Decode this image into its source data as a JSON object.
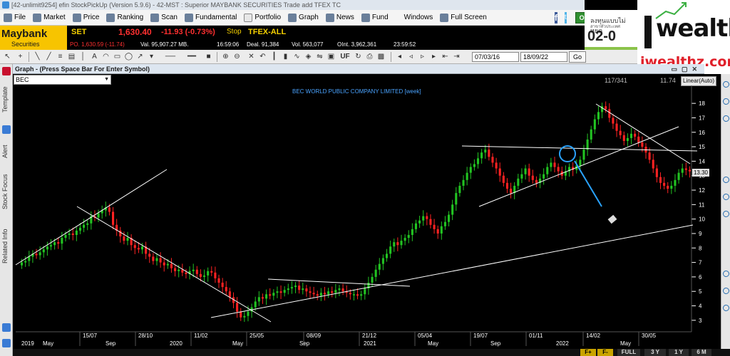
{
  "title_bar": "[42-unlimit9254] efin StockPickUp (Version 5.9.6) - 42-MST : Superior MAYBANK SECURITIES Trade add TFEX TC",
  "menu": [
    {
      "label": "File",
      "icon": "file-icon"
    },
    {
      "label": "Market",
      "icon": "market-icon"
    },
    {
      "label": "Price",
      "icon": "price-icon"
    },
    {
      "label": "Ranking",
      "icon": "ranking-icon"
    },
    {
      "label": "Scan",
      "icon": "scan-icon"
    },
    {
      "label": "Fundamental",
      "icon": "fundamental-icon"
    },
    {
      "label": "Portfolio",
      "icon": "portfolio-icon"
    },
    {
      "label": "Graph",
      "icon": "graph-icon"
    },
    {
      "label": "News",
      "icon": "news-icon"
    },
    {
      "label": "Fund",
      "icon": "fund-icon"
    },
    {
      "label": "Windows",
      "icon": ""
    },
    {
      "label": "Full Screen",
      "icon": "fullscreen-icon"
    }
  ],
  "social": {
    "facebook": "f",
    "twitter": "t"
  },
  "online_label": "ONLINE",
  "broker": {
    "name": "Maybank",
    "sub": "Securities"
  },
  "ticker": {
    "set_label": "SET",
    "set_value": "1,630.40",
    "set_change": "-11.93 (-0.73%)",
    "status": "Stop",
    "po": "PO. 1,630.59 (-11.74)",
    "val": "Val. 95,907.27 MB.",
    "time1": "16:59:06",
    "tfex_label": "TFEX-ALL",
    "deal": "Deal. 91,384",
    "vol": "Vol. 563,077",
    "oint": "OInt. 3,962,361",
    "time2": "23:59:52"
  },
  "ad": {
    "thai": "ลงทุนแบบไม่หยุด",
    "sub": "สาขาทั่วประเทศ",
    "big": "02-0"
  },
  "iwealthz": {
    "brand": "wealthz",
    "url": "iwealthz.com"
  },
  "toolbar": {
    "date_from": "07/03/16",
    "date_to": "18/09/22",
    "go": "Go",
    "uf": "UF"
  },
  "left_tabs": [
    "Template",
    "Alert",
    "Stock Focus",
    "Related Info"
  ],
  "graph_header": "Graph - (Press Space Bar For Enter Symbol)",
  "symbol": "BEC",
  "counter": "117/341",
  "last_price": "11.74",
  "scale_mode": "Linear(Auto)",
  "price_tag": "13.30",
  "bottom_buttons": [
    "FULL",
    "3 Y",
    "1 Y",
    "6 M"
  ],
  "colors": {
    "up": "#22c422",
    "down": "#ff2222",
    "annotation_circle": "#2aa3ff"
  },
  "chart_data": {
    "type": "candlestick",
    "title": "BEC WORLD PUBLIC COMPANY LIMITED [week]",
    "y_ticks": [
      3,
      4,
      5,
      6,
      7,
      8,
      9,
      10,
      11,
      12,
      13,
      14,
      15,
      16,
      17,
      18
    ],
    "ylim": [
      2.5,
      18.5
    ],
    "x_ticks_top": [
      "15/07",
      "28/10",
      "11/02",
      "25/05",
      "08/09",
      "21/12",
      "05/04",
      "19/07",
      "01/11",
      "14/02",
      "30/05"
    ],
    "x_ticks_bottom": [
      "2019",
      "May",
      "Sep",
      "2020",
      "May",
      "Sep",
      "2021",
      "May",
      "Sep",
      "2022",
      "May"
    ],
    "closes": [
      7.0,
      7.1,
      7.4,
      7.6,
      7.5,
      7.7,
      7.9,
      8.1,
      8.2,
      8.4,
      8.3,
      8.7,
      8.9,
      9.0,
      8.9,
      9.2,
      9.4,
      9.6,
      9.7,
      10.2,
      10.1,
      10.4,
      10.6,
      10.8,
      10.5,
      9.6,
      9.2,
      8.8,
      8.5,
      8.7,
      8.2,
      8.0,
      7.9,
      8.1,
      7.6,
      7.4,
      7.1,
      7.3,
      7.0,
      6.8,
      6.9,
      6.6,
      6.4,
      6.5,
      6.3,
      6.2,
      6.4,
      6.5,
      6.2,
      6.0,
      6.1,
      6.4,
      6.3,
      5.9,
      5.6,
      5.3,
      5.0,
      4.6,
      4.2,
      3.6,
      3.2,
      3.3,
      3.6,
      3.9,
      4.3,
      4.6,
      4.5,
      4.8,
      4.7,
      4.9,
      5.0,
      4.9,
      5.1,
      5.2,
      5.3,
      5.4,
      5.1,
      5.2,
      5.0,
      4.9,
      4.8,
      4.7,
      4.9,
      4.8,
      5.0,
      4.9,
      5.1,
      5.2,
      5.0,
      4.9,
      4.8,
      4.8,
      4.7,
      4.8,
      5.2,
      5.6,
      6.0,
      6.5,
      6.9,
      7.3,
      7.6,
      8.1,
      8.4,
      8.2,
      8.5,
      8.7,
      8.9,
      9.3,
      9.7,
      9.9,
      10.2,
      10.0,
      9.6,
      9.3,
      9.0,
      9.5,
      9.8,
      10.3,
      11.0,
      11.8,
      12.3,
      12.7,
      13.2,
      13.6,
      13.8,
      14.2,
      14.6,
      14.8,
      14.3,
      13.9,
      13.5,
      13.0,
      12.5,
      12.1,
      11.8,
      12.3,
      12.8,
      13.1,
      13.5,
      13.0,
      12.7,
      12.5,
      12.8,
      13.1,
      13.6,
      13.9,
      13.6,
      13.3,
      13.0,
      13.3,
      13.6,
      13.4,
      13.7,
      14.1,
      14.8,
      15.5,
      16.2,
      16.9,
      17.4,
      17.8,
      17.6,
      17.0,
      16.6,
      16.1,
      15.8,
      15.4,
      15.6,
      15.9,
      15.7,
      15.3,
      15.0,
      14.6,
      14.1,
      13.5,
      12.9,
      12.5,
      12.3,
      12.1,
      12.3,
      12.7,
      13.2,
      13.5,
      13.4,
      13.3
    ]
  }
}
